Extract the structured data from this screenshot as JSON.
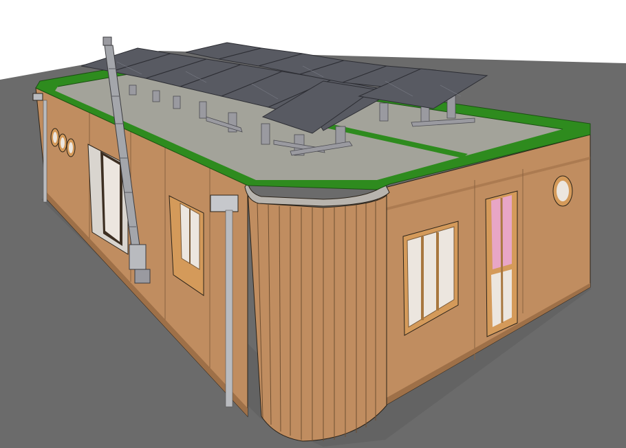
{
  "colors": {
    "background": "#ffffff",
    "ground": "#6b6b6b",
    "timber_wall": "#c08d60",
    "timber_wall_shade": "#b07f55",
    "timber_wall_dark": "#9e7048",
    "roof_surface": "#a3a39a",
    "parapet_green": "#2e8b1e",
    "solar_panel": "#585a62",
    "solar_frame": "#9a9aa0",
    "window_frame": "#d49a5a",
    "glass": "#ece6df",
    "glass_pink": "#e8a6c6",
    "downpipe": "#b9bbbf",
    "coping": "#b8b4ae",
    "outline": "#2a2218"
  },
  "icons": [
    "chimney-flue",
    "downpipe",
    "porthole-window",
    "solar-panel-array"
  ]
}
